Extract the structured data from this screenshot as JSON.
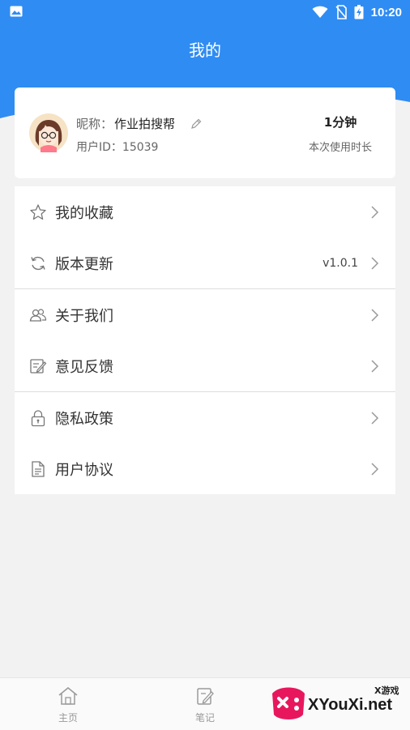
{
  "status_bar": {
    "time": "10:20"
  },
  "header": {
    "title": "我的"
  },
  "profile": {
    "nickname_label": "昵称：",
    "nickname": "作业拍搜帮",
    "user_id_label": "用户ID：",
    "user_id": "15039",
    "usage_value": "1分钟",
    "usage_label": "本次使用时长"
  },
  "menu_groups": [
    {
      "items": [
        {
          "label": "我的收藏",
          "icon": "star-icon"
        },
        {
          "label": "版本更新",
          "icon": "refresh-icon",
          "value": "v1.0.1"
        }
      ]
    },
    {
      "items": [
        {
          "label": "关于我们",
          "icon": "users-icon"
        },
        {
          "label": "意见反馈",
          "icon": "feedback-icon"
        }
      ]
    },
    {
      "items": [
        {
          "label": "隐私政策",
          "icon": "lock-icon"
        },
        {
          "label": "用户协议",
          "icon": "document-icon"
        }
      ]
    }
  ],
  "tab_bar": {
    "tabs": [
      {
        "label": "主页",
        "icon": "home-icon"
      },
      {
        "label": "笔记",
        "icon": "note-icon"
      }
    ]
  },
  "watermark": {
    "text": "XYouXi.net",
    "small": "X游戏"
  },
  "colors": {
    "primary": "#2f8cf3",
    "background": "#f2f2f2",
    "card": "#ffffff"
  }
}
